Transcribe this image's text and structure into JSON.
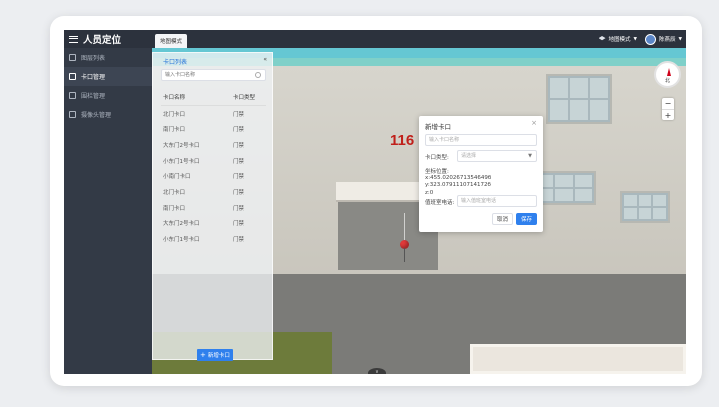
{
  "app": {
    "title": "人员定位"
  },
  "sidebar": {
    "items": [
      {
        "label": "图层列表",
        "icon": "layers-icon"
      },
      {
        "label": "卡口管理",
        "icon": "checkpoint-icon",
        "active": true
      },
      {
        "label": "围栏管理",
        "icon": "fence-icon"
      },
      {
        "label": "摄像头管理",
        "icon": "camera-icon"
      }
    ]
  },
  "header": {
    "tab": "地图模式",
    "mode_label": "地图模式",
    "user_name": "陈燕辰"
  },
  "map": {
    "wall_number": "116",
    "compass_label": "北",
    "zoom_in": "+",
    "zoom_out": "−",
    "bottom_toggle": "∨"
  },
  "checkpoint_panel": {
    "title": "卡口列表",
    "collapse": "«",
    "search_placeholder": "输入卡口名称",
    "columns": [
      "卡口名称",
      "卡口类型"
    ],
    "rows": [
      {
        "name": "北门卡口",
        "type": "门禁"
      },
      {
        "name": "南门卡口",
        "type": "门禁"
      },
      {
        "name": "大东门2号卡口",
        "type": "门禁"
      },
      {
        "name": "小东门1号卡口",
        "type": "门禁"
      },
      {
        "name": "小南门卡口",
        "type": "门禁"
      },
      {
        "name": "北门卡口",
        "type": "门禁"
      },
      {
        "name": "南门卡口",
        "type": "门禁"
      },
      {
        "name": "大东门2号卡口",
        "type": "门禁"
      },
      {
        "name": "小东门1号卡口",
        "type": "门禁"
      }
    ],
    "add_button": "新增卡口"
  },
  "dialog": {
    "title": "新增卡口",
    "close": "×",
    "name_placeholder": "输入卡口名称",
    "type_label": "卡口类型:",
    "type_placeholder": "请选择",
    "coord_label": "坐标位置:",
    "x": "x:455.0202671354649б",
    "y": "y:323.0791110714172б",
    "z": "z:0",
    "phone_label": "值班室电话:",
    "phone_placeholder": "输入值班室电话",
    "cancel": "取消",
    "save": "保存"
  },
  "colors": {
    "accent": "#2f80ed",
    "sidebar": "#333a46",
    "wall_number": "#c0201b"
  }
}
